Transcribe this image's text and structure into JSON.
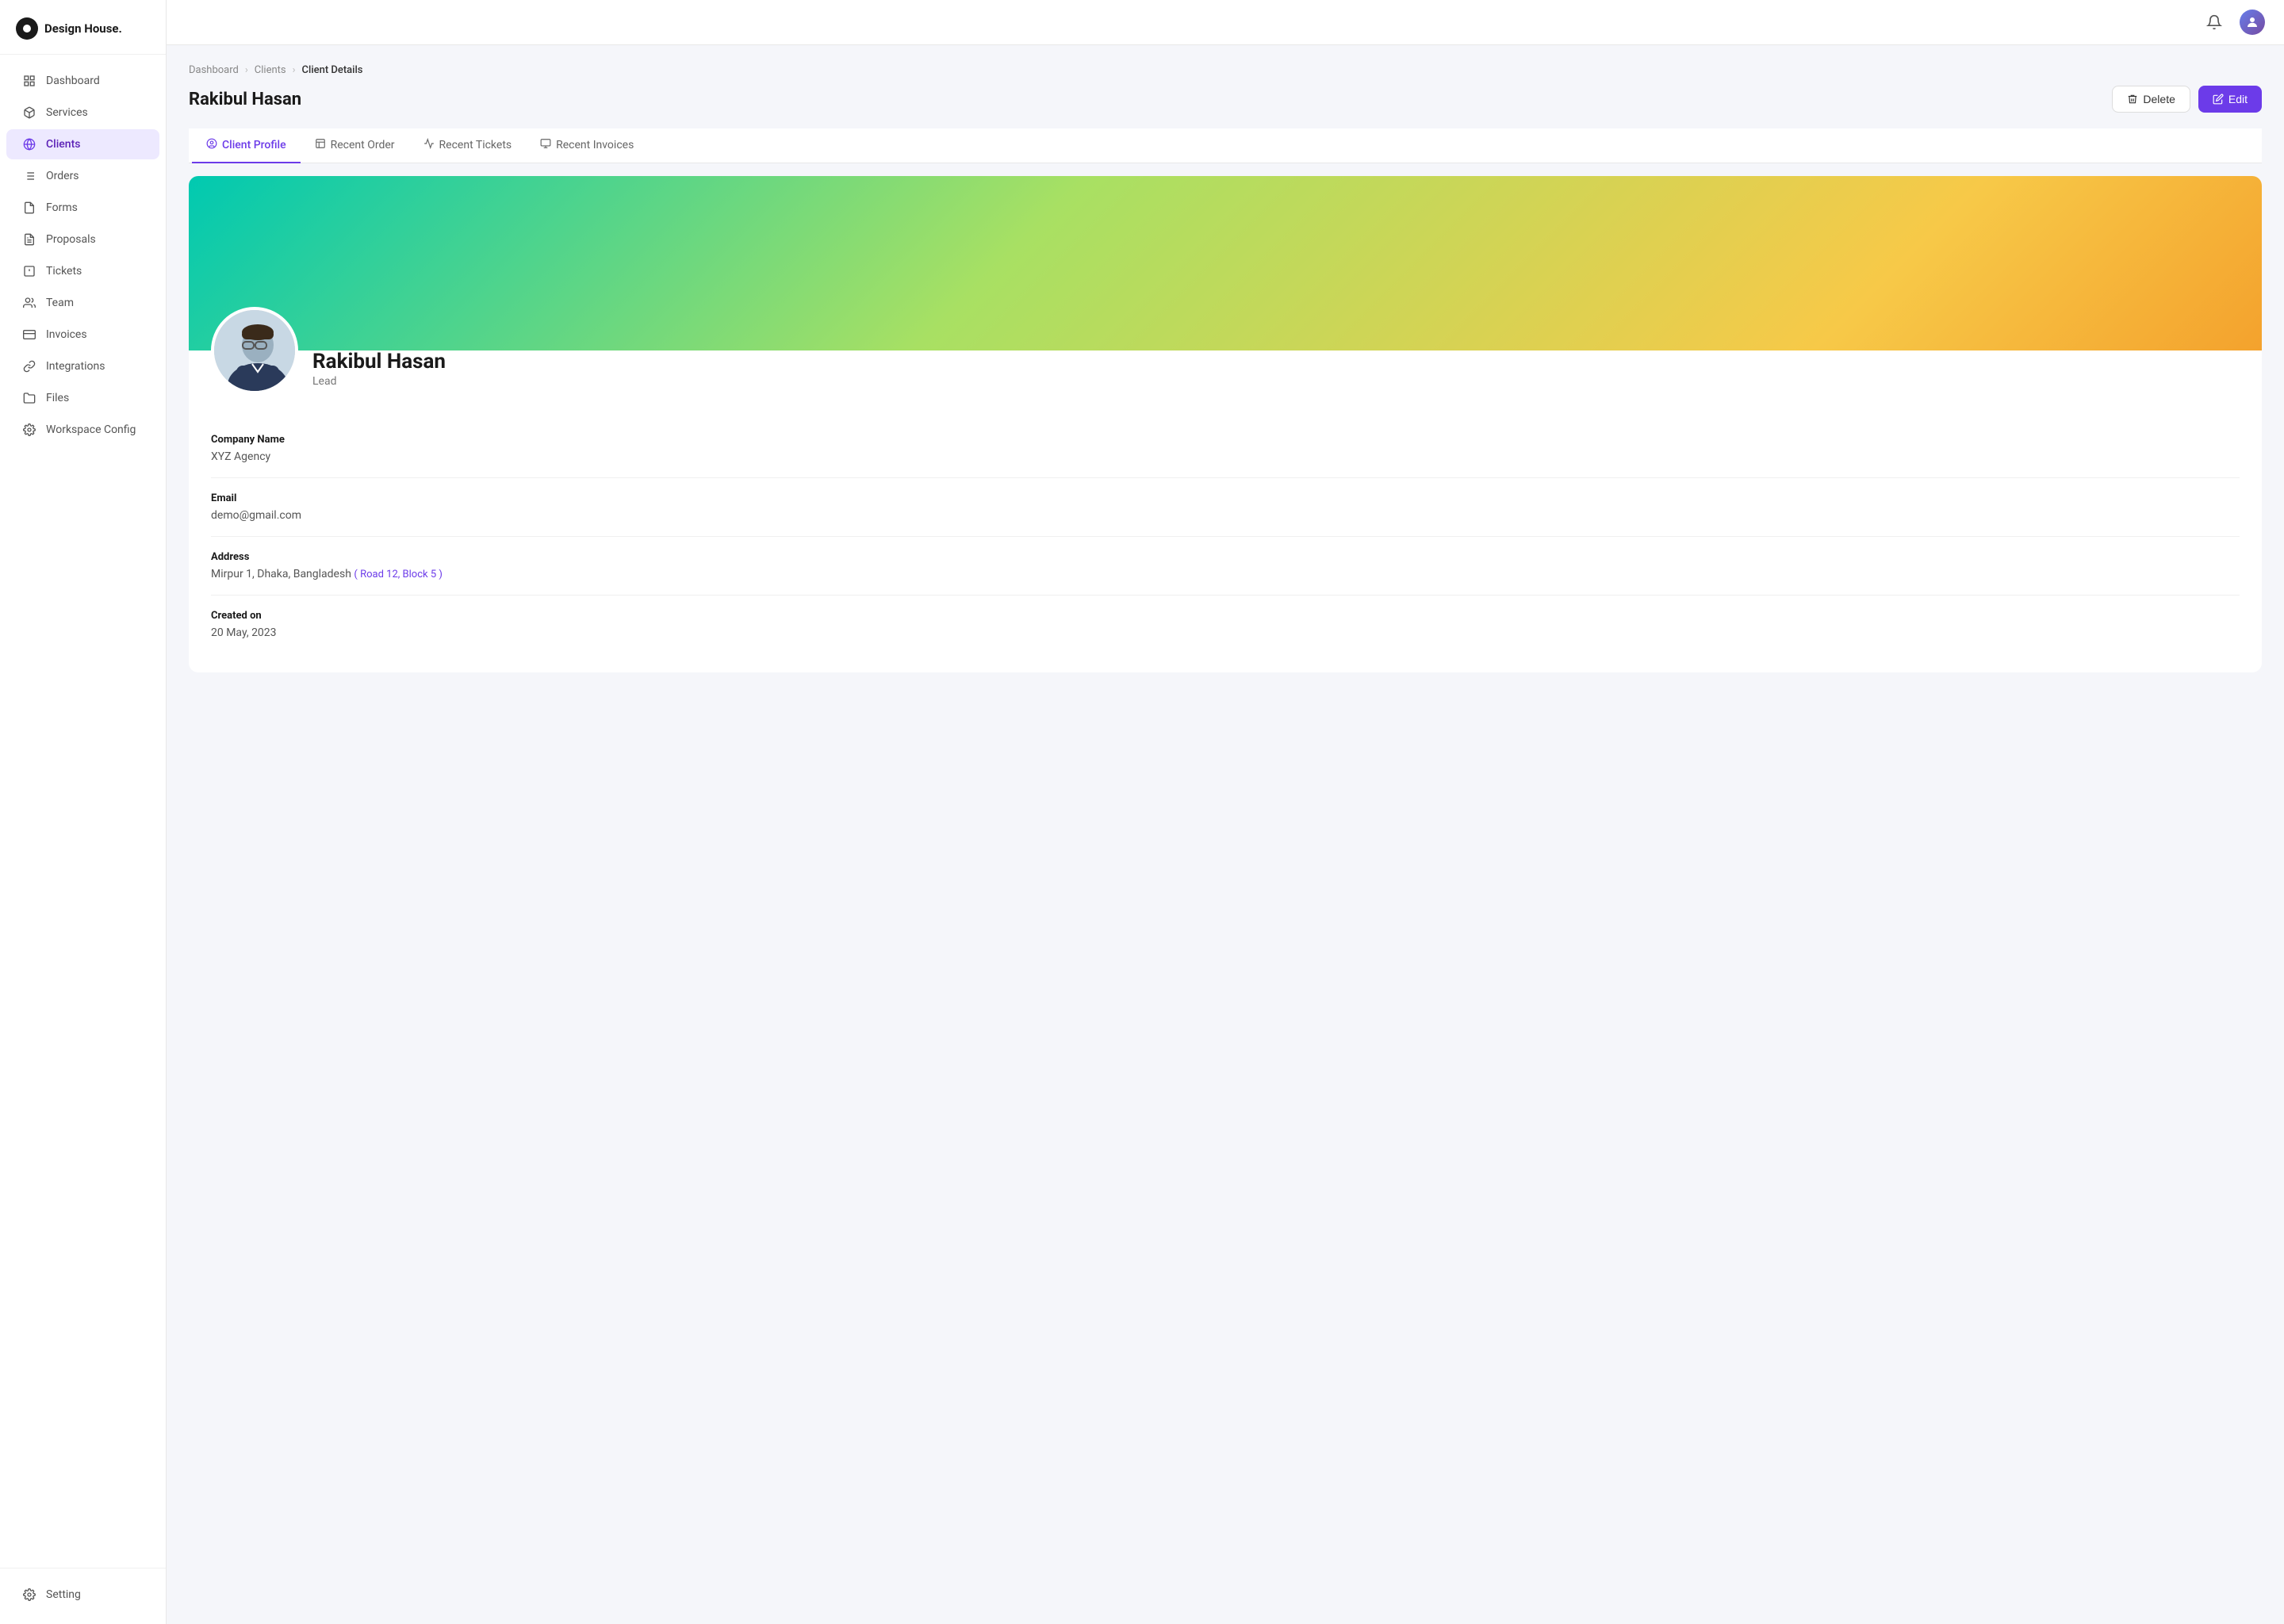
{
  "app": {
    "name": "Design House."
  },
  "sidebar": {
    "nav_items": [
      {
        "id": "dashboard",
        "label": "Dashboard",
        "icon": "grid"
      },
      {
        "id": "services",
        "label": "Services",
        "icon": "package"
      },
      {
        "id": "clients",
        "label": "Clients",
        "icon": "globe",
        "active": true
      },
      {
        "id": "orders",
        "label": "Orders",
        "icon": "list"
      },
      {
        "id": "forms",
        "label": "Forms",
        "icon": "file"
      },
      {
        "id": "proposals",
        "label": "Proposals",
        "icon": "file-text"
      },
      {
        "id": "tickets",
        "label": "Tickets",
        "icon": "alert-square"
      },
      {
        "id": "team",
        "label": "Team",
        "icon": "users"
      },
      {
        "id": "invoices",
        "label": "Invoices",
        "icon": "credit-card"
      },
      {
        "id": "integrations",
        "label": "Integrations",
        "icon": "link"
      },
      {
        "id": "files",
        "label": "Files",
        "icon": "folder"
      },
      {
        "id": "workspace-config",
        "label": "Workspace Config",
        "icon": "settings"
      }
    ],
    "bottom_items": [
      {
        "id": "setting",
        "label": "Setting",
        "icon": "settings"
      }
    ]
  },
  "breadcrumb": {
    "items": [
      "Dashboard",
      "Clients",
      "Client Details"
    ]
  },
  "page": {
    "title": "Rakibul Hasan",
    "delete_label": "Delete",
    "edit_label": "Edit"
  },
  "tabs": [
    {
      "id": "client-profile",
      "label": "Client Profile",
      "active": true
    },
    {
      "id": "recent-order",
      "label": "Recent Order",
      "active": false
    },
    {
      "id": "recent-tickets",
      "label": "Recent Tickets",
      "active": false
    },
    {
      "id": "recent-invoices",
      "label": "Recent Invoices",
      "active": false
    }
  ],
  "profile": {
    "name": "Rakibul Hasan",
    "role": "Lead",
    "fields": [
      {
        "label": "Company Name",
        "value": "XYZ Agency",
        "extra": null
      },
      {
        "label": "Email",
        "value": "demo@gmail.com",
        "extra": null
      },
      {
        "label": "Address",
        "value": "Mirpur 1, Dhaka, Bangladesh",
        "extra": "( Road 12, Block 5 )"
      },
      {
        "label": "Created on",
        "value": "20 May, 2023",
        "extra": null
      }
    ]
  }
}
